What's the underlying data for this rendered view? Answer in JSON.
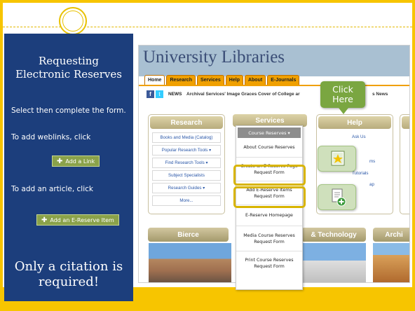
{
  "left_panel": {
    "title": "Requesting\nElectronic Reserves",
    "instruction": "Select then complete the form.",
    "weblinks_label": "To add weblinks, click",
    "add_link_button": "Add a Link",
    "article_label": "To add an article, click",
    "add_reserve_button": "Add an E-Reserve Item",
    "footer": "Only a citation is required!"
  },
  "site": {
    "title": "University Libraries",
    "nav": [
      "Home",
      "Research",
      "Services",
      "Help",
      "About",
      "E-Journals"
    ],
    "news_label": "NEWS",
    "news_text": "Archival Services' Image Graces Cover of College ar",
    "news_tail": "s News"
  },
  "research": {
    "heading": "Research",
    "links": [
      "Books and Media (Catalog)",
      "Popular Research Tools ▾",
      "Find Research Tools ▾",
      "Subject Specialists",
      "Research Guides ▾",
      "More..."
    ]
  },
  "services": {
    "heading": "Services",
    "dropdown_button": "Course Reserves ▾",
    "items": [
      "About Course Reserves",
      "Create an E-Reserve Page Request Form",
      "Add E-Reserve Items Request Form",
      "E-Reserve Homepage",
      "Media Course Reserves Request Form",
      "Print Course Reserves Request Form"
    ]
  },
  "help": {
    "heading": "Help",
    "links": [
      "Ask Us",
      "ms",
      "Tutorials",
      "ap"
    ]
  },
  "bottom_sections": [
    "Bierce",
    "& Technology",
    "Archi"
  ],
  "callout": "Click\nHere",
  "colors": {
    "accent": "#f7c500",
    "panel": "#1c3e7c",
    "callout": "#7aa641"
  }
}
